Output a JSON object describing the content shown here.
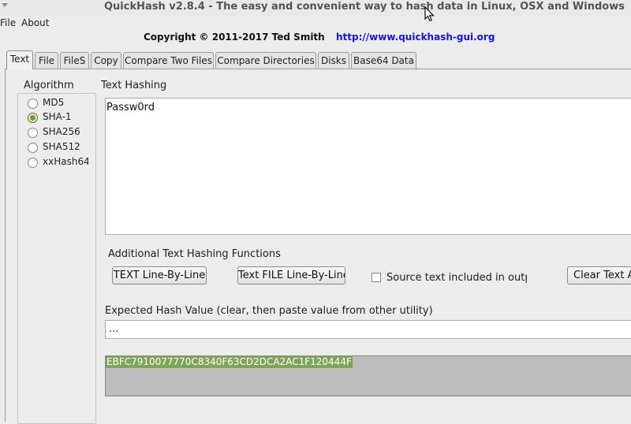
{
  "window": {
    "title": "QuickHash v2.8.4 - The easy and convenient way to hash data in Linux, OSX and Windows"
  },
  "menu": [
    "File",
    "About"
  ],
  "header": {
    "copyright": "Copyright © 2011-2017  Ted Smith",
    "website": "http://www.quickhash-gui.org"
  },
  "tabs": [
    {
      "label": "Text",
      "active": true
    },
    {
      "label": "File"
    },
    {
      "label": "FileS"
    },
    {
      "label": "Copy"
    },
    {
      "label": "Compare Two Files"
    },
    {
      "label": "Compare Directories"
    },
    {
      "label": "Disks"
    },
    {
      "label": "Base64 Data"
    }
  ],
  "algorithm": {
    "label": "Algorithm",
    "options": [
      "MD5",
      "SHA-1",
      "SHA256",
      "SHA512",
      "xxHash64"
    ],
    "selected": "SHA-1"
  },
  "text_hashing": {
    "label": "Text Hashing",
    "input_value": "Passw0rd"
  },
  "additional": {
    "label": "Additional Text Hashing Functions",
    "btn_line_by_line": "TEXT Line-By-Line",
    "btn_file_line_by_line": "Text FILE Line-By-Line",
    "checkbox_label": "Source text included in output",
    "btn_clear": "Clear Text Area"
  },
  "expected": {
    "label": "Expected Hash Value (clear, then paste value from other utility)",
    "value": "..."
  },
  "result": {
    "hash": "EBFC7910077770C8340F63CD2DCA2AC1F120444F"
  },
  "colors": {
    "selection": "#7fa55a",
    "link": "#1515e8"
  }
}
